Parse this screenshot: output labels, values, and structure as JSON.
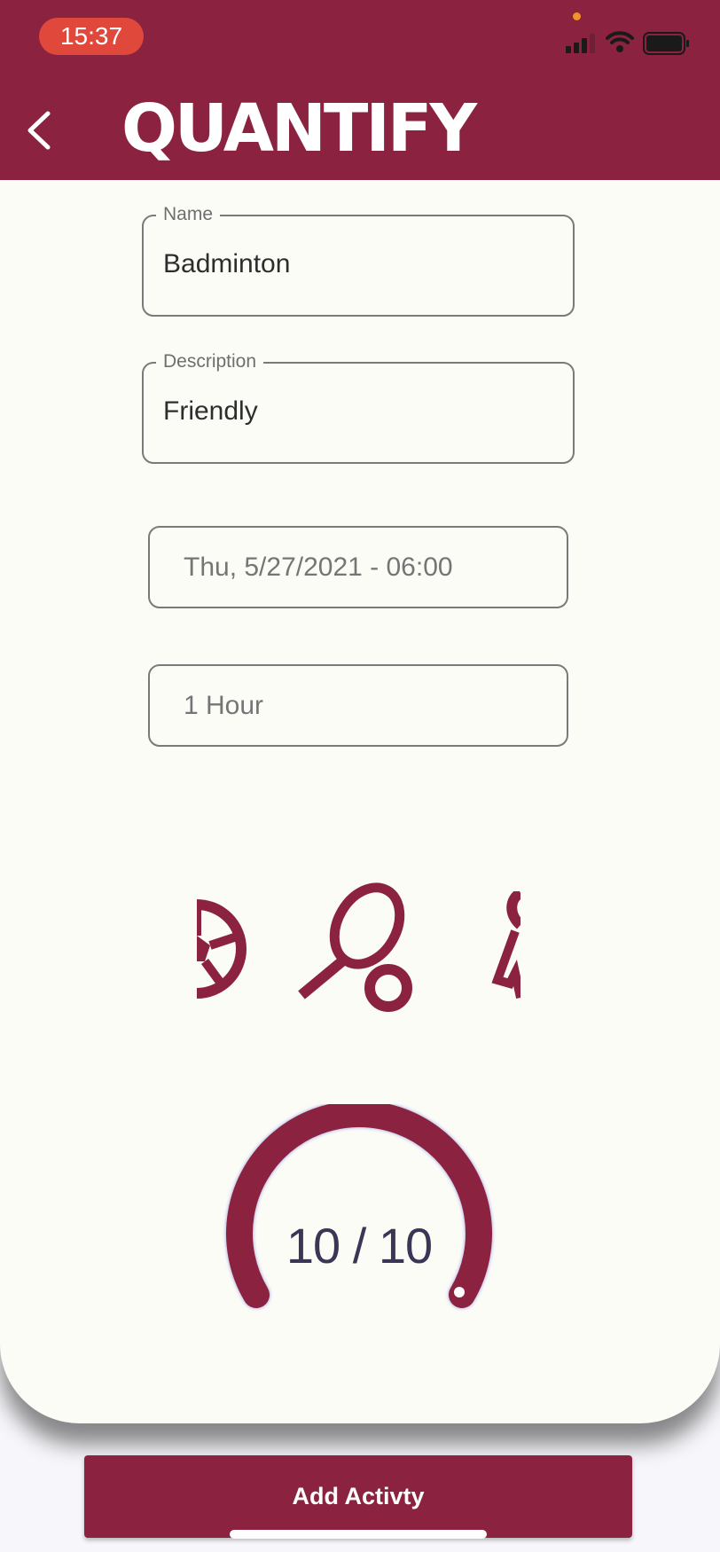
{
  "status_bar": {
    "time": "15:37"
  },
  "header": {
    "title": "QUANTIFY",
    "back_icon": "chevron-left-icon"
  },
  "form": {
    "name": {
      "label": "Name",
      "value": "Badminton"
    },
    "description": {
      "label": "Description",
      "value": "Friendly"
    },
    "datetime": "Thu, 5/27/2021 - 06:00",
    "duration": "1 Hour"
  },
  "activity_icons": [
    "soccer-ball-icon",
    "badminton-racket-icon",
    "running-person-icon"
  ],
  "rating": {
    "text": "10 / 10",
    "value": 10,
    "max": 10
  },
  "footer": {
    "add_button": "Add Activty"
  },
  "colors": {
    "brand": "#8b2340",
    "background": "#fcfcf7",
    "time_pill": "#e0483c"
  }
}
